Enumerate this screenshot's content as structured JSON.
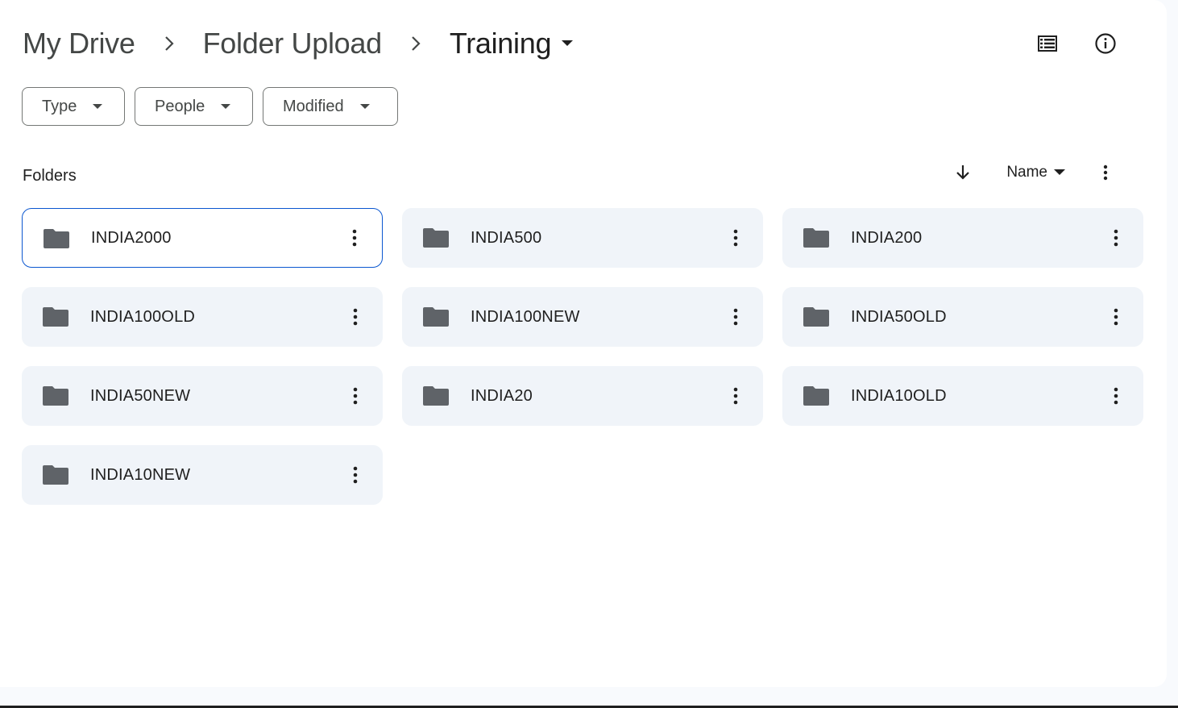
{
  "breadcrumb": {
    "items": [
      "My Drive",
      "Folder Upload"
    ],
    "current": "Training"
  },
  "header": {
    "icons": [
      "list-view-icon",
      "info-icon"
    ]
  },
  "filters": [
    {
      "label": "Type"
    },
    {
      "label": "People"
    },
    {
      "label": "Modified"
    }
  ],
  "section": {
    "label": "Folders",
    "sort_field": "Name",
    "sort_direction_icon": "arrow-down-icon"
  },
  "folders": [
    {
      "name": "INDIA2000",
      "selected": true
    },
    {
      "name": "INDIA500",
      "selected": false
    },
    {
      "name": "INDIA200",
      "selected": false
    },
    {
      "name": "INDIA100OLD",
      "selected": false
    },
    {
      "name": "INDIA100NEW",
      "selected": false
    },
    {
      "name": "INDIA50OLD",
      "selected": false
    },
    {
      "name": "INDIA50NEW",
      "selected": false
    },
    {
      "name": "INDIA20",
      "selected": false
    },
    {
      "name": "INDIA10OLD",
      "selected": false
    },
    {
      "name": "INDIA10NEW",
      "selected": false
    }
  ],
  "colors": {
    "accent": "#0b57d0",
    "card_bg": "#f0f4f9",
    "icon": "#5f6368"
  }
}
